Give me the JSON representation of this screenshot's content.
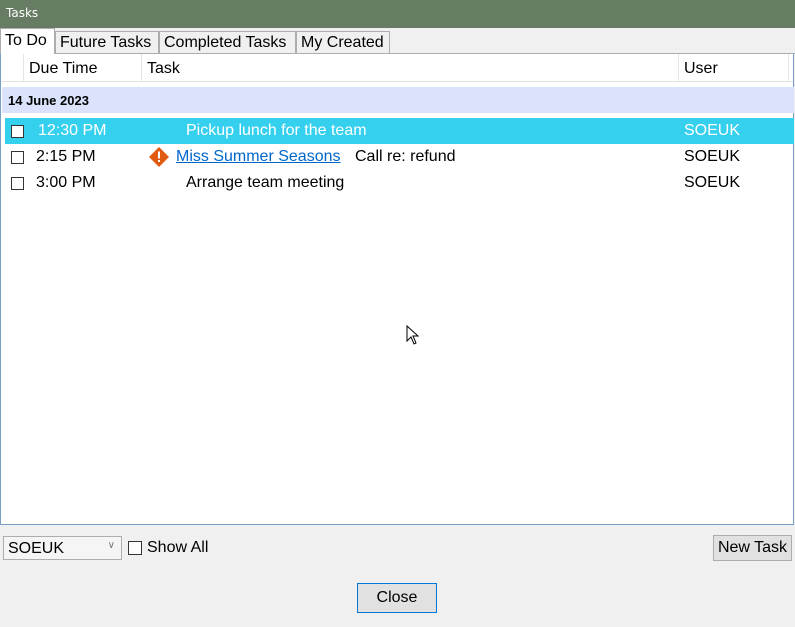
{
  "window": {
    "title": "Tasks"
  },
  "tabs": [
    {
      "label": "To Do",
      "active": true
    },
    {
      "label": "Future Tasks",
      "active": false
    },
    {
      "label": "Completed Tasks",
      "active": false
    },
    {
      "label": "My Created",
      "active": false
    }
  ],
  "columns": {
    "due_time": "Due Time",
    "task": "Task",
    "user": "User"
  },
  "group": {
    "date": "14 June 2023"
  },
  "rows": [
    {
      "due_time": "12:30 PM",
      "task": "Pickup lunch for the team",
      "user": "SOEUK",
      "selected": true,
      "checked": false
    },
    {
      "due_time": "2:15 PM",
      "link": "Miss Summer Seasons",
      "task": "Call re: refund",
      "user": "SOEUK",
      "selected": false,
      "checked": false,
      "icon": "warning-icon"
    },
    {
      "due_time": "3:00 PM",
      "task": "Arrange team meeting",
      "user": "SOEUK",
      "selected": false,
      "checked": false
    }
  ],
  "footer": {
    "user_select": "SOEUK",
    "show_all_label": "Show All",
    "show_all_checked": false,
    "new_task_label": "New Task",
    "close_label": "Close"
  },
  "colors": {
    "titlebar": "#667d64",
    "selected_row": "#36d0ef",
    "group_header": "#dae3fb",
    "link": "#0066cc",
    "warning": "#e05a10"
  }
}
